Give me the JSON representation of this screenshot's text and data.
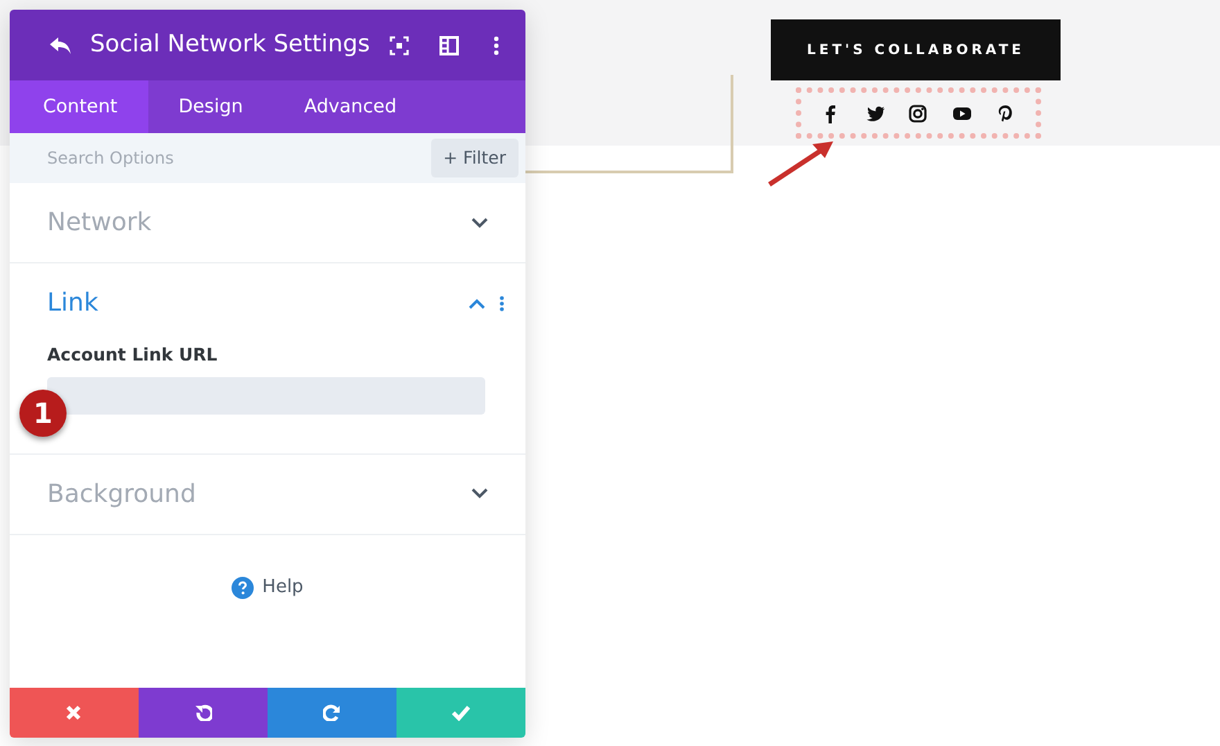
{
  "panel": {
    "title": "Social Network Settings",
    "tabs": [
      {
        "label": "Content",
        "selected": true
      },
      {
        "label": "Design",
        "selected": false
      },
      {
        "label": "Advanced",
        "selected": false
      }
    ],
    "search": {
      "placeholder": "Search Options"
    },
    "filter_button": "+ Filter",
    "sections": [
      {
        "title": "Network",
        "expanded": false
      },
      {
        "title": "Link",
        "expanded": true,
        "field": {
          "label": "Account Link URL"
        }
      },
      {
        "title": "Background",
        "expanded": false
      }
    ],
    "help": "Help",
    "footer_buttons": [
      {
        "kind": "cancel"
      },
      {
        "kind": "undo"
      },
      {
        "kind": "redo"
      },
      {
        "kind": "save"
      }
    ]
  },
  "step_badge": "1",
  "cta_button": "LET'S COLLABORATE",
  "social_icons": [
    {
      "kind": "facebook"
    },
    {
      "kind": "twitter"
    },
    {
      "kind": "instagram"
    },
    {
      "kind": "youtube"
    },
    {
      "kind": "pinterest"
    }
  ]
}
